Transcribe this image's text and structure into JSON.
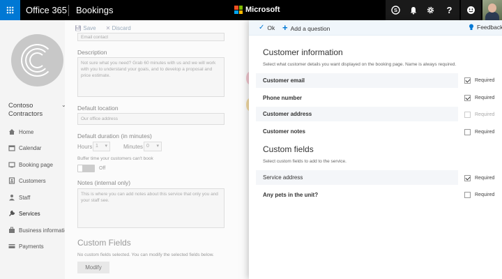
{
  "topbar": {
    "app_name": "Office 365",
    "product": "Bookings",
    "brand": "Microsoft",
    "icons": [
      "skype-icon",
      "bell-icon",
      "gear-icon",
      "help-icon",
      "smiley-icon"
    ]
  },
  "business": {
    "name": "Contoso Contractors"
  },
  "nav": [
    {
      "label": "Home",
      "icon": "home-icon"
    },
    {
      "label": "Calendar",
      "icon": "calendar-icon"
    },
    {
      "label": "Booking page",
      "icon": "booking-page-icon"
    },
    {
      "label": "Customers",
      "icon": "customers-icon"
    },
    {
      "label": "Staff",
      "icon": "staff-icon"
    },
    {
      "label": "Services",
      "icon": "services-icon"
    },
    {
      "label": "Business information",
      "icon": "business-info-icon"
    },
    {
      "label": "Payments",
      "icon": "payments-icon"
    }
  ],
  "form": {
    "save_label": "Save",
    "discard_label": "Discard",
    "email_value": "Email contact",
    "description_label": "Description",
    "description_value": "Not sure what you need? Grab 60 minutes with us and we will work with you to understand your goals, and to develop a proposal and price estimate.",
    "location_label": "Default location",
    "location_value": "Our office address",
    "duration_label": "Default duration (in minutes)",
    "hours_label": "Hours",
    "hours_value": "1",
    "minutes_label": "Minutes",
    "minutes_value": "0",
    "buffer_label": "Buffer time your customers can't book",
    "buffer_state": "Off",
    "notes_label": "Notes (internal only)",
    "notes_value": "This is where you can add notes about this service that only you and your staff see.",
    "custom_fields_heading": "Custom Fields",
    "custom_fields_desc": "No custom fields selected. You can modify the selected fields below.",
    "modify_label": "Modify"
  },
  "panel": {
    "ok_label": "Ok",
    "add_question_label": "Add a question",
    "feedback_label": "Feedback",
    "customer_info_title": "Customer information",
    "customer_info_desc": "Select what customer details you want displayed on the booking page. Name is always required.",
    "customer_fields": [
      {
        "label": "Customer email",
        "required_label": "Required",
        "required": true
      },
      {
        "label": "Phone number",
        "required_label": "Required",
        "required": true
      },
      {
        "label": "Customer address",
        "required_label": "Required",
        "required": false,
        "disabled": true
      },
      {
        "label": "Customer notes",
        "required_label": "Required",
        "required": false
      }
    ],
    "custom_fields_title": "Custom fields",
    "custom_fields_desc": "Select custom fields to add to the service.",
    "custom_fields": [
      {
        "label": "Service address",
        "required_label": "Required",
        "required": true
      },
      {
        "label": "Any pets in the unit?",
        "required_label": "Required",
        "required": false
      }
    ]
  },
  "colors": {
    "accent": "#0078d4",
    "topbar": "#000000",
    "panel_bar": "#f0f6fb"
  }
}
